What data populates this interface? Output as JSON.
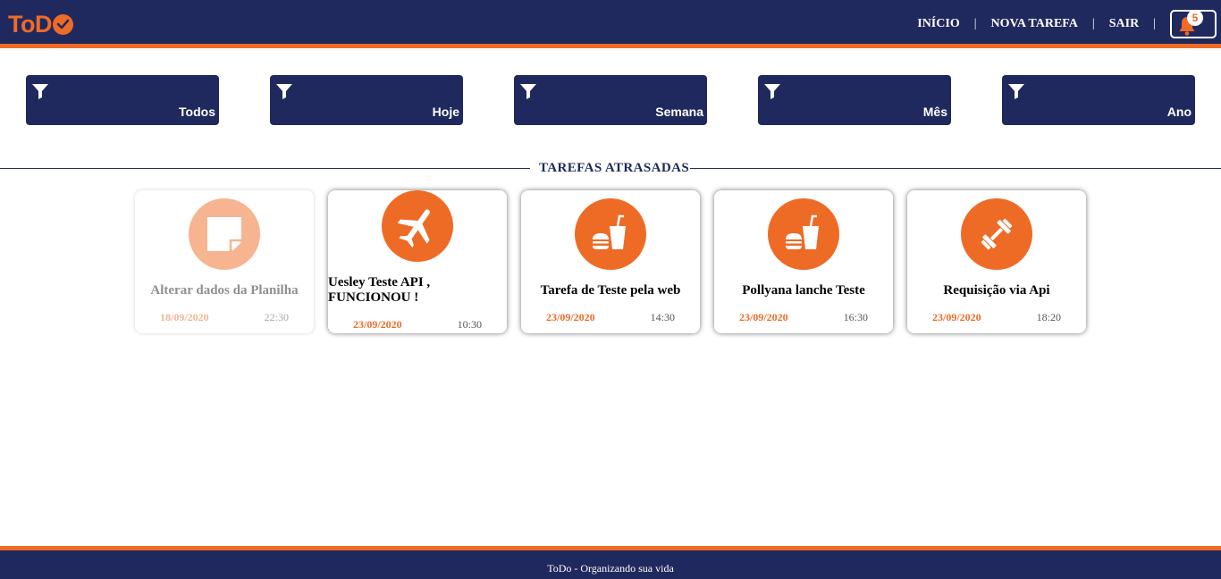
{
  "app": {
    "logo_text": "ToD",
    "brand_color": "#ee6b26",
    "nav_color": "#20295e"
  },
  "nav": {
    "inicio": "INÍCIO",
    "nova_tarefa": "NOVA TAREFA",
    "sair": "SAIR",
    "separator": "|",
    "notification_count": "5"
  },
  "filters": [
    {
      "label": "Todos",
      "icon": "filter-icon"
    },
    {
      "label": "Hoje",
      "icon": "filter-icon"
    },
    {
      "label": "Semana",
      "icon": "filter-icon"
    },
    {
      "label": "Mês",
      "icon": "filter-icon"
    },
    {
      "label": "Ano",
      "icon": "filter-icon"
    }
  ],
  "section": {
    "title": "TAREFAS ATRASADAS"
  },
  "tasks": [
    {
      "title": "Alterar dados da Planilha",
      "date": "18/09/2020",
      "time": "22:30",
      "icon": "note-icon",
      "done": true
    },
    {
      "title": "Uesley Teste API , FUNCIONOU !",
      "date": "23/09/2020",
      "time": "10:30",
      "icon": "airplane-icon",
      "done": false
    },
    {
      "title": "Tarefa de Teste pela web",
      "date": "23/09/2020",
      "time": "14:30",
      "icon": "food-drink-icon",
      "done": false
    },
    {
      "title": "Pollyana lanche Teste",
      "date": "23/09/2020",
      "time": "16:30",
      "icon": "food-drink-icon",
      "done": false
    },
    {
      "title": "Requisição via Api",
      "date": "23/09/2020",
      "time": "18:20",
      "icon": "dumbbell-icon",
      "done": false
    }
  ],
  "footer": {
    "text": "ToDo - Organizando sua vida"
  }
}
